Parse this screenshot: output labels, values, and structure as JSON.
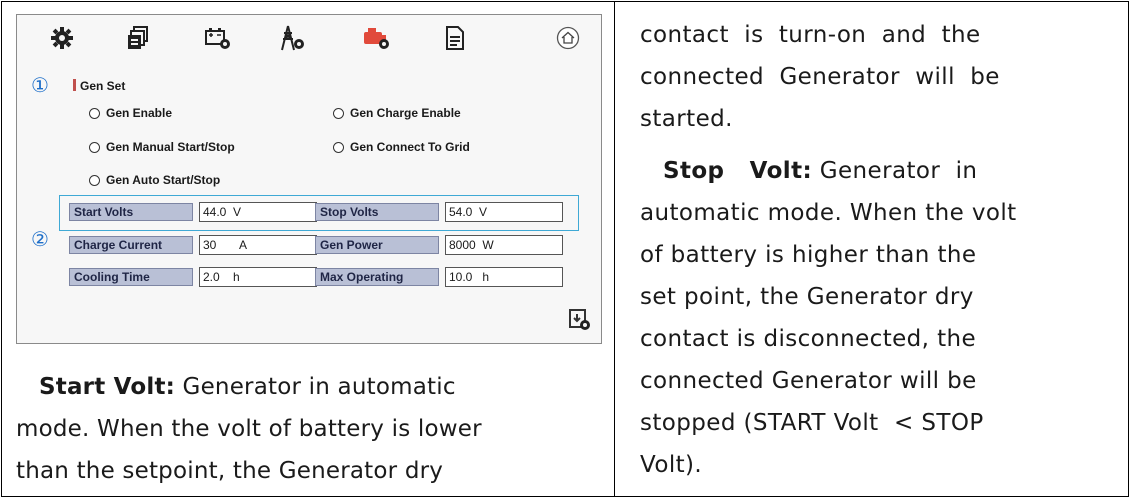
{
  "screenshot": {
    "toolbar_icons": [
      "gear-icon",
      "battery-stack-icon",
      "battery-settings-icon",
      "grid-tower-icon",
      "generator-icon",
      "document-icon",
      "home-icon"
    ],
    "markers": [
      "①",
      "②"
    ],
    "section_title": "Gen Set",
    "options": [
      "Gen Enable",
      "Gen Charge Enable",
      "Gen Manual Start/Stop",
      "Gen Connect To Grid",
      "Gen Auto Start/Stop"
    ],
    "fields": [
      {
        "label": "Start Volts",
        "value": "44.0  V"
      },
      {
        "label": "Stop Volts",
        "value": "54.0  V"
      },
      {
        "label": "Charge Current",
        "value": "30       A"
      },
      {
        "label": "Gen Power",
        "value": "8000  W"
      },
      {
        "label": "Cooling Time",
        "value": "2.0    h"
      },
      {
        "label": "Max Operating",
        "value": "10.0   h"
      }
    ]
  },
  "left_text": {
    "term": "Start Volt:",
    "lines": [
      " Generator in automatic",
      "mode. When the volt of battery is lower",
      "than the setpoint,  the Generator dry"
    ]
  },
  "right_text": {
    "lines": [
      "contact  is  turn-on  and  the",
      "connected  Generator  will  be",
      "started."
    ],
    "term": "Stop   Volt:",
    "lines2": [
      " Generator  in",
      "automatic mode. When the volt",
      "of battery is higher than the",
      "set point, the Generator dry",
      "contact is disconnected, the",
      "connected Generator will be",
      "stopped (START Volt  < STOP",
      "Volt)."
    ]
  },
  "colors": {
    "marker": "#1e6fc9",
    "highlight": "#3fa9d5",
    "field_label_bg": "#b9c0d6",
    "generator_icon": "#e14a3b"
  }
}
